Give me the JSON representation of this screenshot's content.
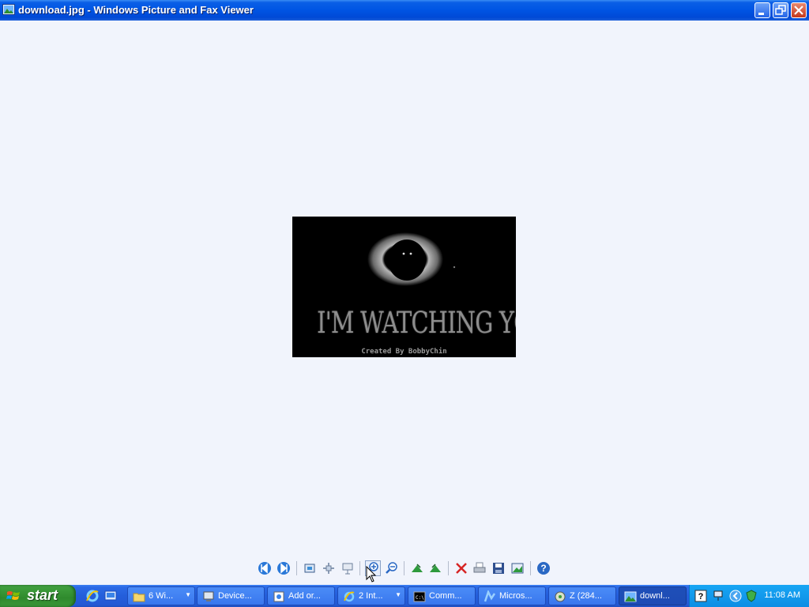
{
  "window": {
    "title": "download.jpg - Windows Picture and Fax Viewer",
    "controls": [
      "minimize",
      "restore",
      "close"
    ]
  },
  "image": {
    "file": "download.jpg",
    "caption": "I'M WATCHING YOU",
    "credit": "Created By BobbyChin"
  },
  "toolbar": {
    "buttons": [
      {
        "name": "previous-image-button",
        "icon": "previous-icon"
      },
      {
        "name": "next-image-button",
        "icon": "next-icon"
      },
      {
        "name": "best-fit-button",
        "icon": "best-fit-icon"
      },
      {
        "name": "actual-size-button",
        "icon": "actual-size-icon"
      },
      {
        "name": "slide-show-button",
        "icon": "slide-show-icon"
      },
      {
        "name": "zoom-in-button",
        "icon": "zoom-in-icon"
      },
      {
        "name": "zoom-out-button",
        "icon": "zoom-out-icon"
      },
      {
        "name": "rotate-clockwise-button",
        "icon": "rotate-clockwise-icon"
      },
      {
        "name": "rotate-counterclockwise-button",
        "icon": "rotate-counterclockwise-icon"
      },
      {
        "name": "delete-button",
        "icon": "delete-icon"
      },
      {
        "name": "print-button",
        "icon": "print-icon"
      },
      {
        "name": "save-button",
        "icon": "save-icon"
      },
      {
        "name": "open-for-editing-button",
        "icon": "edit-icon"
      },
      {
        "name": "help-button",
        "icon": "help-icon"
      }
    ]
  },
  "taskbar": {
    "start_label": "start",
    "tasks": [
      {
        "label": "6 Wi...",
        "icon": "folder-icon",
        "grouped": true
      },
      {
        "label": "Device...",
        "icon": "device-manager-icon"
      },
      {
        "label": "Add or...",
        "icon": "add-remove-icon"
      },
      {
        "label": "2 Int...",
        "icon": "internet-explorer-icon",
        "grouped": true
      },
      {
        "label": "Comm...",
        "icon": "command-prompt-icon"
      },
      {
        "label": "Micros...",
        "icon": "microsoft-icon"
      },
      {
        "label": "Z (284...",
        "icon": "drive-icon"
      },
      {
        "label": "downl...",
        "icon": "picture-viewer-icon",
        "active": true
      }
    ],
    "clock": "11:08 AM"
  },
  "colors": {
    "titlebar": "#0054e3",
    "viewer_background": "#f1f4fc",
    "taskbar": "#245edb",
    "start_button": "#3c9b3a",
    "tray": "#0d8de4"
  }
}
